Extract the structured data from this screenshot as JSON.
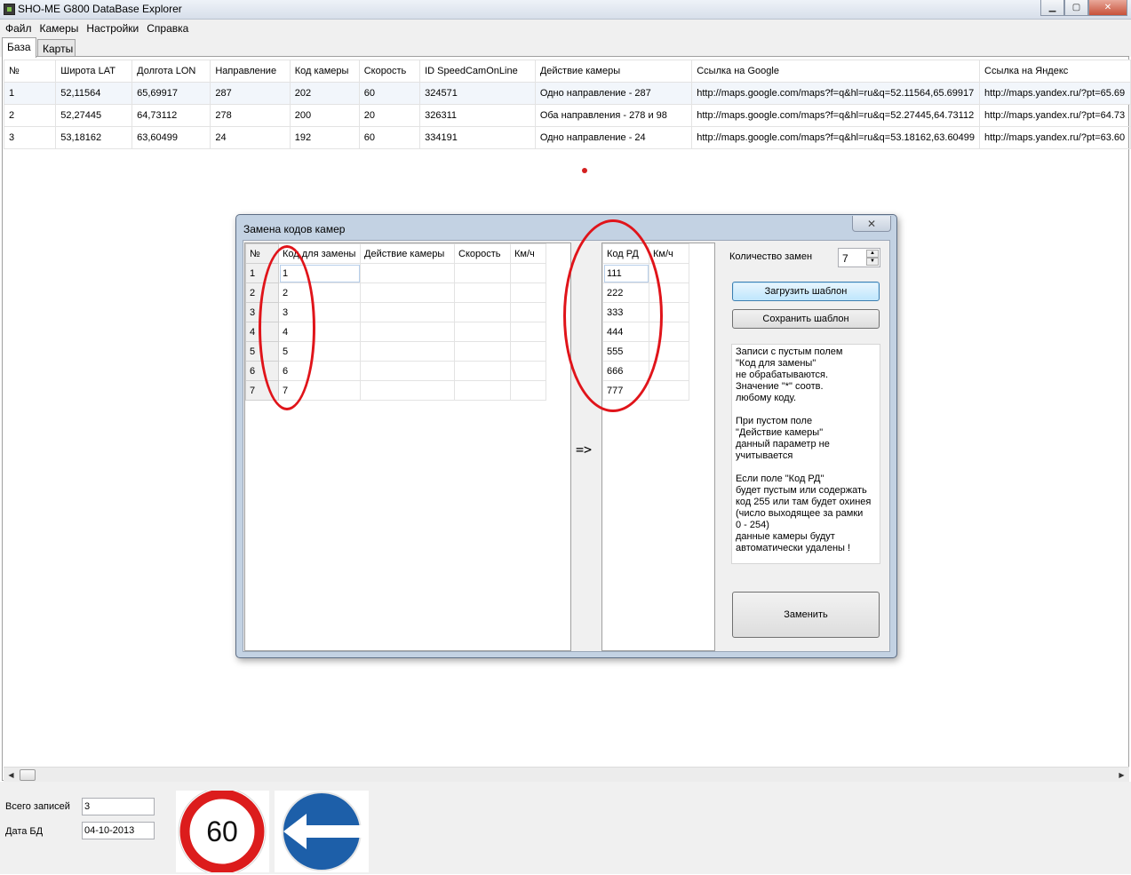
{
  "window": {
    "title": "SHO-ME G800 DataBase Explorer",
    "controls": {
      "minimize": "▁",
      "maximize": "▢",
      "close": "✕"
    }
  },
  "menu": [
    "Файл",
    "Камеры",
    "Настройки",
    "Справка"
  ],
  "tabs": [
    {
      "label": "База",
      "active": true
    },
    {
      "label": "Карты",
      "active": false
    }
  ],
  "grid": {
    "columns": [
      "№",
      "Широта LAT",
      "Долгота LON",
      "Направление",
      "Код камеры",
      "Скорость",
      "ID SpeedCamOnLine",
      "Действие камеры",
      "Ссылка на Google",
      "Ссылка на Яндекс"
    ],
    "rows": [
      [
        "1",
        "52,11564",
        "65,69917",
        "287",
        "202",
        "60",
        "324571",
        "Одно направление - 287",
        "http://maps.google.com/maps?f=q&hl=ru&q=52.11564,65.69917",
        "http://maps.yandex.ru/?pt=65.69"
      ],
      [
        "2",
        "52,27445",
        "64,73112",
        "278",
        "200",
        "20",
        "326311",
        "Оба направления - 278 и 98",
        "http://maps.google.com/maps?f=q&hl=ru&q=52.27445,64.73112",
        "http://maps.yandex.ru/?pt=64.73"
      ],
      [
        "3",
        "53,18162",
        "63,60499",
        "24",
        "192",
        "60",
        "334191",
        "Одно направление - 24",
        "http://maps.google.com/maps?f=q&hl=ru&q=53.18162,63.60499",
        "http://maps.yandex.ru/?pt=63.60"
      ]
    ]
  },
  "status": {
    "total_label": "Всего записей",
    "total_value": "3",
    "date_label": "Дата БД",
    "date_value": "04-10-2013",
    "speed_sign": "60"
  },
  "dialog": {
    "title": "Замена кодов камер",
    "close": "✕",
    "left_columns": [
      "№",
      "Код для замены",
      "Действие камеры",
      "Скорость",
      "Км/ч"
    ],
    "left_rows": [
      [
        "1",
        "1"
      ],
      [
        "2",
        "2"
      ],
      [
        "3",
        "3"
      ],
      [
        "4",
        "4"
      ],
      [
        "5",
        "5"
      ],
      [
        "6",
        "6"
      ],
      [
        "7",
        "7"
      ]
    ],
    "arrow": "=>",
    "right_columns": [
      "Код РД",
      "Км/ч"
    ],
    "right_rows": [
      "111",
      "222",
      "333",
      "444",
      "555",
      "666",
      "777"
    ],
    "qty_label": "Количество замен",
    "qty_value": "7",
    "load_button": "Загрузить шаблон",
    "save_button": "Сохранить шаблон",
    "note": "Записи с пустым полем\n\"Код для замены\"\nне обрабатываются.\nЗначение \"*\" соотв.\nлюбому коду.\n\nПри пустом поле\n\"Действие камеры\"\nданный параметр не\nучитывается\n\nЕсли поле \"Код РД\"\nбудет пустым или содержать\nкод 255 или там будет охинея\n(число выходящее за рамки\n0 - 254)\nданные камеры будут\nавтоматически удалены !",
    "replace_button": "Заменить"
  }
}
